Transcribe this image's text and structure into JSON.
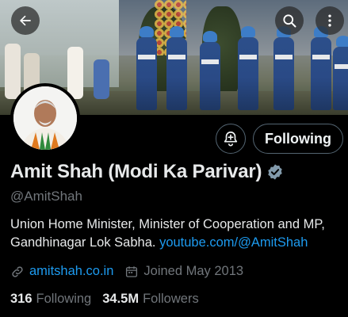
{
  "header": {
    "back_icon": "arrow-left-icon",
    "search_icon": "search-icon",
    "more_icon": "more-vertical-icon"
  },
  "profile": {
    "name": "Amit Shah (Modi Ka Parivar)",
    "handle": "@AmitShah",
    "verified_color": "#829aab",
    "bio_text": "Union Home Minister, Minister of Cooperation and MP, Gandhinagar Lok Sabha. ",
    "bio_link": "youtube.com/@AmitShah",
    "website": "amitshah.co.in",
    "joined": "Joined May 2013"
  },
  "actions": {
    "notify_icon": "bell-plus-icon",
    "following_label": "Following"
  },
  "stats": {
    "following_count": "316",
    "following_label": "Following",
    "followers_count": "34.5M",
    "followers_label": "Followers"
  },
  "colors": {
    "link": "#1d9bf0",
    "muted": "#71767b",
    "background": "#000000"
  }
}
